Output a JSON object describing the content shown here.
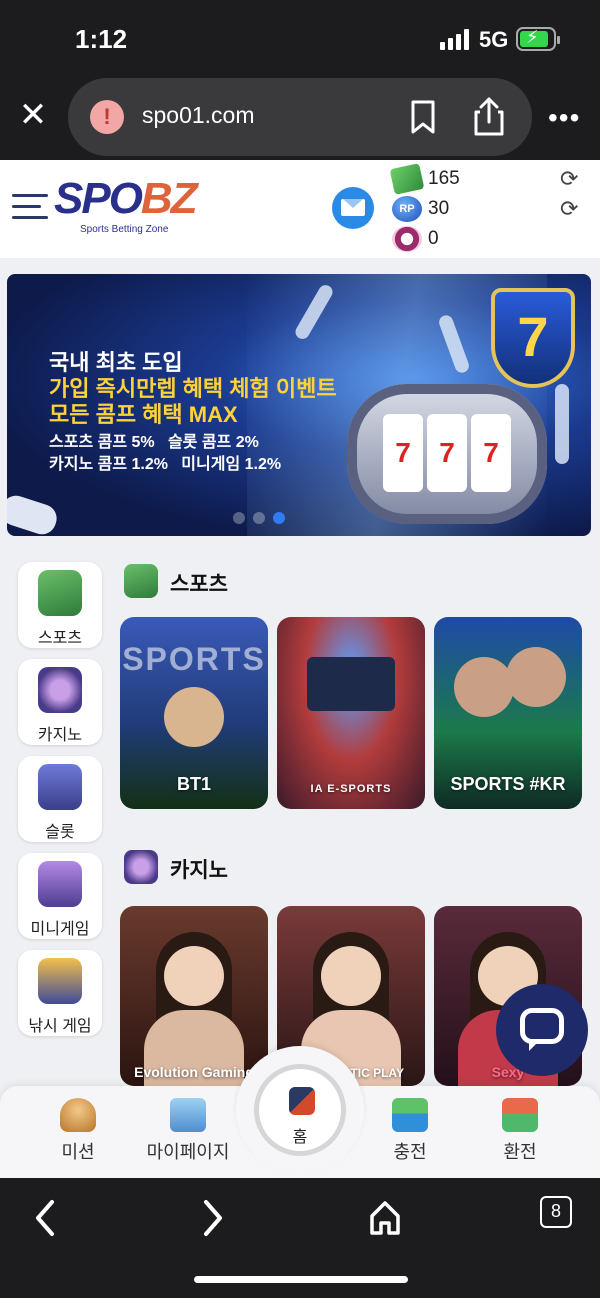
{
  "status_bar": {
    "time": "1:12",
    "network": "5G"
  },
  "browser": {
    "url": "spo01.com",
    "tab_count": "8"
  },
  "site": {
    "logo": {
      "brand_left": "SPO",
      "brand_right": "BZ",
      "tagline": "Sports Betting Zone"
    },
    "balances": [
      {
        "icon": "money-icon",
        "value": "165"
      },
      {
        "icon": "rp-coin-icon",
        "value": "30",
        "badge": "RP"
      },
      {
        "icon": "chip-icon",
        "value": "0"
      }
    ]
  },
  "banner": {
    "line1": "국내 최초 도입",
    "line2": "가입 즉시만렙 혜택 체험 이벤트",
    "line3": "모든 콤프 혜택 MAX",
    "line4": "스포츠 콤프 5%   슬롯 콤프 2%",
    "line5": "카지노 콤프 1.2%   미니게임 1.2%",
    "shield_number": "7",
    "reels": [
      "7",
      "7",
      "7"
    ]
  },
  "sidenav": [
    {
      "label": "스포츠"
    },
    {
      "label": "카지노"
    },
    {
      "label": "슬롯"
    },
    {
      "label": "미니게임"
    },
    {
      "label": "낚시 게임"
    }
  ],
  "sections": {
    "sports": {
      "title": "스포츠",
      "cards": [
        {
          "caption": "BT1",
          "art_text": "SPORTS"
        },
        {
          "caption": "IA E-SPORTS"
        },
        {
          "caption": "SPORTS #KR"
        }
      ]
    },
    "casino": {
      "title": "카지노",
      "cards": [
        {
          "caption": "Evolution Gaming"
        },
        {
          "caption": "PRAGMATIC PLAY"
        },
        {
          "caption": "Sexy"
        }
      ]
    }
  },
  "bottom_nav": {
    "mission": "미션",
    "mypage": "마이페이지",
    "home": "홈",
    "deposit": "충전",
    "withdraw": "환전"
  },
  "colors": {
    "brand_navy": "#2a2f8c",
    "brand_orange": "#e0623a",
    "active_dot": "#2f7df0",
    "chat_fab": "#1f2a6b"
  }
}
